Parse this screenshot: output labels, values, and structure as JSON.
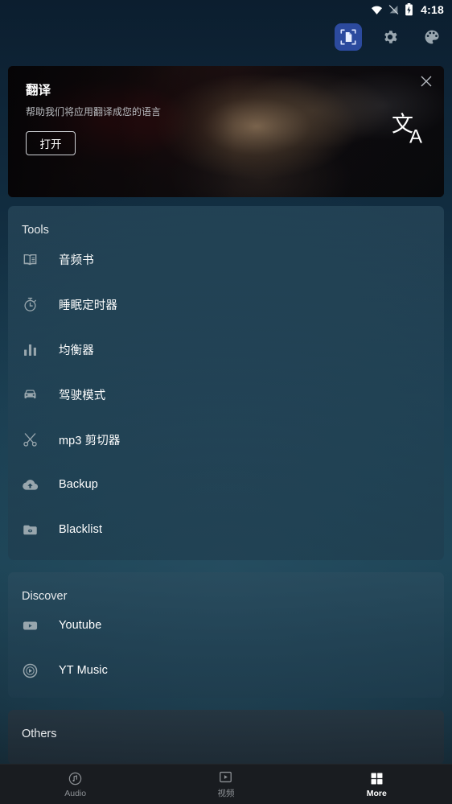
{
  "statusbar": {
    "time": "4:18",
    "icons": [
      "wifi-icon",
      "no-signal-icon",
      "battery-charging-icon"
    ]
  },
  "toolbar": {
    "items": [
      {
        "name": "scan-document-icon",
        "label": "Scan",
        "active": true
      },
      {
        "name": "settings-gear-icon",
        "label": "Settings",
        "active": false
      },
      {
        "name": "theme-palette-icon",
        "label": "Theme",
        "active": false
      }
    ]
  },
  "banner": {
    "title": "翻译",
    "subtitle": "帮助我们将应用翻译成您的语言",
    "button_label": "打开",
    "glyph": "translate-icon",
    "close_label": "close-icon"
  },
  "sections": [
    {
      "title": "Tools",
      "items": [
        {
          "icon": "book-icon",
          "label": "音频书"
        },
        {
          "icon": "timer-icon",
          "label": "睡眠定时器"
        },
        {
          "icon": "equalizer-icon",
          "label": "均衡器"
        },
        {
          "icon": "car-icon",
          "label": "驾驶模式"
        },
        {
          "icon": "scissors-icon",
          "label": "mp3 剪切器"
        },
        {
          "icon": "cloud-upload-icon",
          "label": "Backup"
        },
        {
          "icon": "folder-icon",
          "label": "Blacklist"
        }
      ]
    },
    {
      "title": "Discover",
      "items": [
        {
          "icon": "youtube-icon",
          "label": "Youtube"
        },
        {
          "icon": "yt-music-icon",
          "label": "YT Music"
        }
      ]
    },
    {
      "title": "Others",
      "items": []
    }
  ],
  "bottomnav": [
    {
      "icon": "audio-note-icon",
      "label": "Audio",
      "active": false
    },
    {
      "icon": "video-icon",
      "label": "视频",
      "active": false
    },
    {
      "icon": "grid-more-icon",
      "label": "More",
      "active": true
    }
  ],
  "colors": {
    "accent_blue": "#2c4a9e",
    "page_bg": "#183b4e",
    "card_bg": "#2c4d5f",
    "nav_bg": "#191c20",
    "text_primary": "#ffffff",
    "text_secondary": "#98a6ad"
  }
}
